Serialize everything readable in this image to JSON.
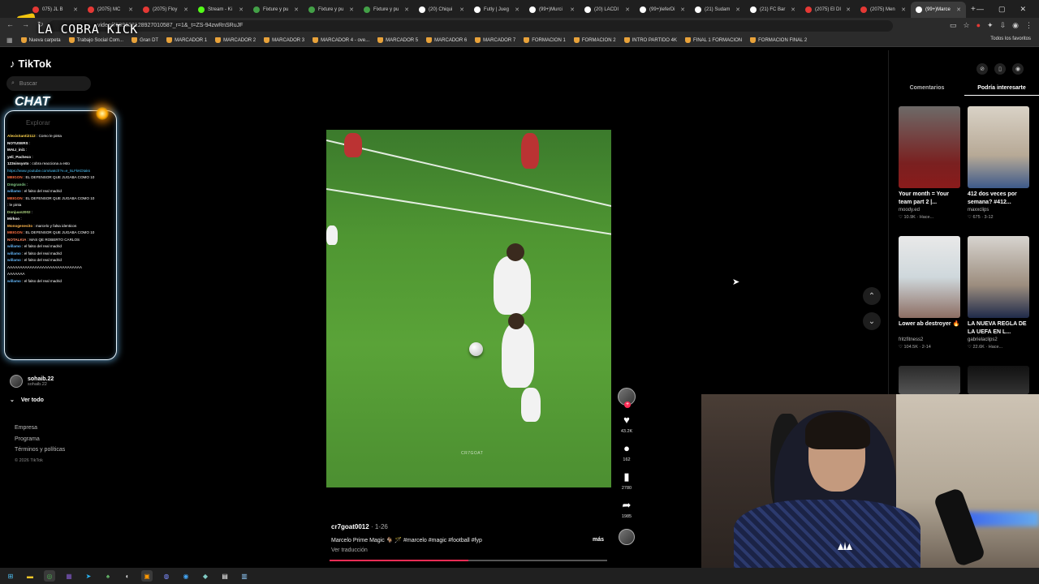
{
  "browser": {
    "tabs": [
      {
        "title": "075) JL B",
        "color": "#e53935"
      },
      {
        "title": "(2075) MC",
        "color": "#e53935"
      },
      {
        "title": "(2075) Floy",
        "color": "#e53935"
      },
      {
        "title": "Stream - Ki",
        "color": "#53fc18"
      },
      {
        "title": "Fixture y pu",
        "color": "#43a047"
      },
      {
        "title": "Fixture y pu",
        "color": "#43a047"
      },
      {
        "title": "Fixture y pu",
        "color": "#43a047"
      },
      {
        "title": "(20) Chiqui",
        "color": "#ffffff"
      },
      {
        "title": "Futly | Jueg",
        "color": "#ffffff"
      },
      {
        "title": "(99+)Murci",
        "color": "#ffffff"
      },
      {
        "title": "(20) LACDI",
        "color": "#ffffff"
      },
      {
        "title": "(99+)leferDi",
        "color": "#ffffff"
      },
      {
        "title": "(21) Sudam",
        "color": "#ffffff"
      },
      {
        "title": "(21) FC Bar",
        "color": "#ffffff"
      },
      {
        "title": "(2075) El DI",
        "color": "#e53935"
      },
      {
        "title": "(2075) Men",
        "color": "#e53935"
      },
      {
        "title": "(99+)Marce",
        "color": "#ffffff",
        "active": true
      }
    ],
    "url": "video/7599628128927010587_r=1&_t=ZS-94zwRnSRuJF",
    "bookmarks": [
      "Nueva carpeta",
      "Trabajo Social Com...",
      "Gran DT",
      "MARCADOR 1",
      "MARCADOR 2",
      "MARCADOR 3",
      "MARCADOR 4 - ove...",
      "MARCADOR 5",
      "MARCADOR 6",
      "MARCADOR 7",
      "FORMACION 1",
      "FORMACION 2",
      "INTRO PARTIDO 4K",
      "FINAL 1 FORMACION",
      "FORMACION FINAL 2"
    ],
    "bookmarks_right": "Todos los favoritos"
  },
  "overlay": {
    "stream_title": "LA COBRA KICK",
    "chat_title": "CHAT",
    "chat_messages": [
      {
        "user": "AlexisSanti2112",
        "text": ": Como le pinta",
        "color": "#ffd54f"
      },
      {
        "user": "NOTUSERS",
        "text": ":",
        "color": "#ffffff"
      },
      {
        "user": "MALI_ini1",
        "text": ":",
        "color": "#ffffff"
      },
      {
        "user": "yeli_Pacheco",
        "text": ":",
        "color": "#ffffff"
      },
      {
        "user": "123sinsyoto",
        "text": ": cobra reacciona a esto",
        "color": "#ffffff"
      },
      {
        "user": "",
        "text": "https://www.youtube.com/watch?v=e_5LFkKDtaks",
        "color": "#4fc3f7"
      },
      {
        "user": "MEIGON",
        "text": ": EL DEFENSOR QUE JUGABA COMO 10",
        "color": "#ff7043"
      },
      {
        "user": "Dmgrands",
        "text": ":",
        "color": "#81c784"
      },
      {
        "user": "willamo",
        "text": ": el falso del real madrid",
        "color": "#64b5f6"
      },
      {
        "user": "MEIGON",
        "text": ": EL DEFENSOR QUE JUGABA COMO 10",
        "color": "#ff7043"
      },
      {
        "user": "",
        "text": ": le pinta",
        "color": "#ffffff"
      },
      {
        "user": "Donjuan2002",
        "text": ":",
        "color": "#aed581"
      },
      {
        "user": "Mirkoo",
        "text": ":",
        "color": "#ffffff"
      },
      {
        "user": "Monogenesito",
        "text": ": marcelo y falsa identicos",
        "color": "#ffb74d"
      },
      {
        "user": "MEIGON",
        "text": ": EL DEFENSOR QUE JUGABA COMO 10",
        "color": "#ff7043"
      },
      {
        "user": "NOTALKIA",
        "text": ": MAS QE ROBERTO CARLOS",
        "color": "#ff8a65"
      },
      {
        "user": "willamo",
        "text": ": el falso del real madrid",
        "color": "#64b5f6"
      },
      {
        "user": "willamo",
        "text": ": el falso del real madrid",
        "color": "#64b5f6"
      },
      {
        "user": "willamo",
        "text": ": el falso del real madrid",
        "color": "#64b5f6"
      },
      {
        "user": "",
        "text": "AAAAAAAAAAAAAAAAAAAAAAAAAAAAAA",
        "color": "#ffffff"
      },
      {
        "user": "",
        "text": "AAAAAAA",
        "color": "#ffffff"
      },
      {
        "user": "willamo",
        "text": ": el falso del real madrid",
        "color": "#64b5f6"
      }
    ]
  },
  "tiktok": {
    "logo_text": "TikTok",
    "search_placeholder": "Buscar",
    "explorar_label": "Explorar",
    "followed": {
      "name": "sohaib.22",
      "handle": "sohaib.22"
    },
    "ver_todo": "Ver todo",
    "footer_links": [
      "Empresa",
      "Programa",
      "Términos y políticas"
    ],
    "copyright": "© 2026 TikTok",
    "video": {
      "watermark": "CR7GOAT",
      "author": "cr7goat0012",
      "date": "· 1-26",
      "caption": "Marcelo Prime Magic 🐐 🪄 #marcelo #magic #football #fyp",
      "more": "más",
      "translate": "Ver traducción",
      "progress": 0.5
    },
    "actions": {
      "likes": "43.2K",
      "comments": "162",
      "saves": "2780",
      "shares": "1985"
    },
    "right_tabs": [
      "Comentarios",
      "Podría interesarte"
    ],
    "recommended": [
      {
        "title": "Your month = Your team part 2 |...",
        "author": "moody.ed",
        "likes": "10.9K",
        "date": "· Hace..."
      },
      {
        "title": "412 dos veces por semana? #412...",
        "author": "maxxclips",
        "likes": "675",
        "date": "· 3-12"
      },
      {
        "title": "Lower ab destroyer 🔥",
        "author": "fritzfitness2",
        "likes": "104.5K",
        "date": "· 2-14"
      },
      {
        "title": "LA NUEVA REGLA DE LA UEFA EN L...",
        "author": "gabrielaclips2",
        "likes": "22.6K",
        "date": "· Hace..."
      }
    ]
  }
}
